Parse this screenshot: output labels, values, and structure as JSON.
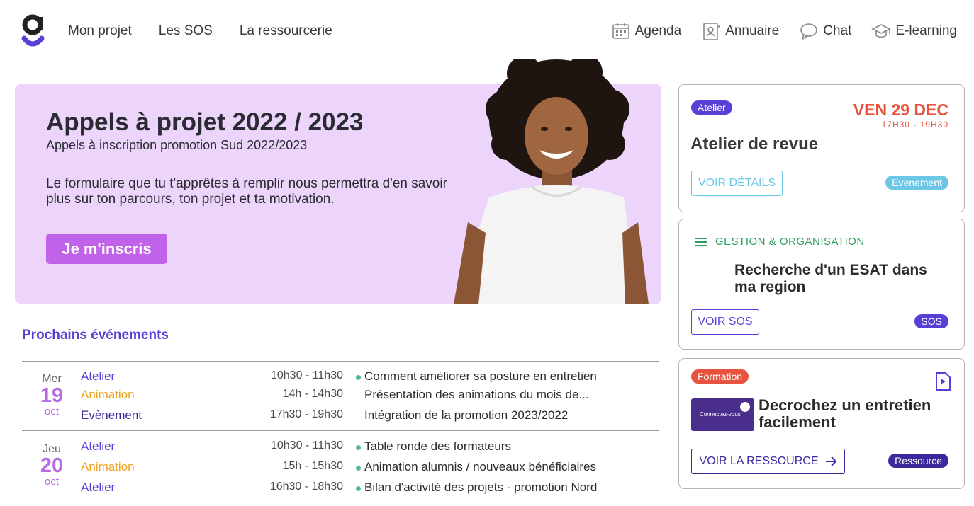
{
  "nav": {
    "left": [
      "Mon projet",
      "Les SOS",
      "La ressourcerie"
    ],
    "right": [
      {
        "label": "Agenda",
        "icon": "calendar-icon"
      },
      {
        "label": "Annuaire",
        "icon": "contact-card-icon"
      },
      {
        "label": "Chat",
        "icon": "chat-bubble-icon"
      },
      {
        "label": "E-learning",
        "icon": "graduation-cap-icon"
      }
    ]
  },
  "hero": {
    "title": "Appels à projet 2022 / 2023",
    "subtitle": "Appels à inscription promotion Sud 2022/2023",
    "text": "Le formulaire que tu t'apprêtes à remplir nous permettra d'en savoir plus sur ton parcours, ton projet et ta motivation.",
    "button": "Je m'inscris"
  },
  "events": {
    "title": "Prochains événements",
    "days": [
      {
        "name": "Mer",
        "num": "19",
        "month": "oct",
        "rows": [
          {
            "type": "Atelier",
            "time": "10h30 - 11h30",
            "desc": "Comment améliorer sa posture en entretien",
            "dot": true
          },
          {
            "type": "Animation",
            "time": "14h - 14h30",
            "desc": "Présentation des animations du mois de...",
            "dot": false
          },
          {
            "type": "Evènement",
            "time": "17h30 - 19h30",
            "desc": "Intégration de la promotion 2023/2022",
            "dot": false
          }
        ]
      },
      {
        "name": "Jeu",
        "num": "20",
        "month": "oct",
        "rows": [
          {
            "type": "Atelier",
            "time": "10h30 - 11h30",
            "desc": "Table ronde des formateurs",
            "dot": true
          },
          {
            "type": "Animation",
            "time": "15h - 15h30",
            "desc": "Animation alumnis / nouveaux bénéficiaires",
            "dot": true
          },
          {
            "type": "Atelier",
            "time": "16h30 - 18h30",
            "desc": "Bilan d'activité des projets - promotion Nord",
            "dot": true
          }
        ]
      }
    ]
  },
  "colors": {
    "Atelier": "#5a3fd6",
    "Animation": "#f0a21b",
    "Evènement": "#3a2a9c"
  },
  "cards": {
    "event": {
      "badge": "Atelier",
      "date": "VEN 29 DEC",
      "time": "17H30 - 19H30",
      "title": "Atelier de revue",
      "button": "VOIR DÉTAILS",
      "tag": "Evenement"
    },
    "sos": {
      "category": "GESTION & ORGANISATION",
      "title": "Recherche d'un ESAT dans ma region",
      "button": "VOIR SOS",
      "tag": "SOS"
    },
    "resource": {
      "badge": "Formation",
      "thumb_text": "Connectez-vous",
      "title": "Decrochez un entretien facilement",
      "button": "VOIR LA RESSOURCE",
      "tag": "Ressource"
    }
  }
}
